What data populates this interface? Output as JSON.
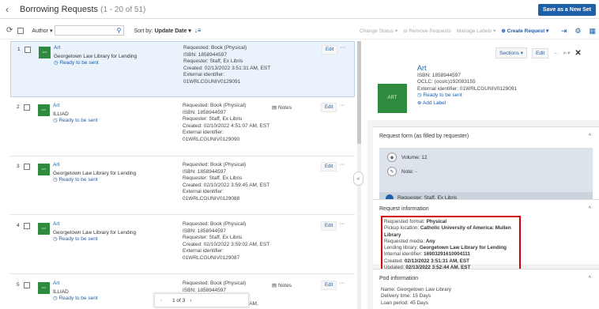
{
  "header": {
    "title": "Borrowing Requests",
    "count": "(1 - 20 of 51)",
    "save_set": "Save as a New Set"
  },
  "toolbar": {
    "facet": "Author ▾",
    "search_placeholder": "",
    "sort_label": "Sort by:",
    "sort_value": "Update Date ▾",
    "actions": [
      "Change Status ▾",
      "Remove Requests",
      "Manage Labels ▾"
    ],
    "create": "Create Request ▾"
  },
  "rows": [
    {
      "n": "1",
      "title": "Art",
      "lib": "Georgetown Law Library for Lending",
      "status": "Ready to be sent",
      "req": "Requested: Book (Physical)",
      "isbn": "ISBN: 1858944597",
      "requester": "Requester: Staff, Ex Libris",
      "created": "Created: 02/13/2022 3:51:31 AM, EST",
      "ext": "External identifier:",
      "extid": "01WRLCGUNIV0129091",
      "notes": ""
    },
    {
      "n": "2",
      "title": "Art",
      "lib": "ILLIAD",
      "status": "Ready to be sent",
      "req": "Requested: Book (Physical)",
      "isbn": "ISBN: 1858944597",
      "requester": "Requester: Staff, Ex Libris",
      "created": "Created: 02/10/2022 4:51:07 AM, EST",
      "ext": "External identifier:",
      "extid": "01WRLCGUNIV0129090",
      "notes": "Notes"
    },
    {
      "n": "3",
      "title": "Art",
      "lib": "Georgetown Law Library for Lending",
      "status": "Ready to be sent",
      "req": "Requested: Book (Physical)",
      "isbn": "ISBN: 1858944597",
      "requester": "Requester: Staff, Ex Libris",
      "created": "Created: 02/10/2022 3:59:45 AM, EST",
      "ext": "External identifier:",
      "extid": "01WRLCGUNIV0129088",
      "notes": ""
    },
    {
      "n": "4",
      "title": "Art",
      "lib": "Georgetown Law Library for Lending",
      "status": "Ready to be sent",
      "req": "Requested: Book (Physical)",
      "isbn": "ISBN: 1858944597",
      "requester": "Requester: Staff, Ex Libris",
      "created": "Created: 02/10/2022 3:59:02 AM, EST",
      "ext": "External identifier:",
      "extid": "01WRLCGUNIV0129087",
      "notes": ""
    },
    {
      "n": "5",
      "title": "Art",
      "lib": "ILLIAD",
      "status": "Ready to be sent",
      "req": "Requested: Book (Physical)",
      "isbn": "ISBN: 1858944597",
      "requester": "Requester: Staff, Ex Libris",
      "created": "Created: 02/10/2022 3:50:25 AM,",
      "ext": "",
      "extid": "",
      "notes": "Notes"
    }
  ],
  "row_actions": {
    "edit": "Edit",
    "more": "···"
  },
  "pager": {
    "label": "1 of 3"
  },
  "panel": {
    "sections_btn": "Sections ▾",
    "edit_btn": "Edit",
    "title": "Art",
    "isbn": "ISBN: 1858944597",
    "oclc": "OCLC: (ocolc)192083155",
    "extid": "External identifier: 01WRLCGUNIV0129091",
    "status": "Ready to be sent",
    "add_label": "Add Label",
    "form_section": "Request form (as filled by requester)",
    "volume": "Volume: 12",
    "note": "Note: -",
    "requester": "Requester: Staff, Ex Libris",
    "info_section": "Request information",
    "info": [
      {
        "k": "Requested format:",
        "v": "Physical"
      },
      {
        "k": "Pickup location:",
        "v": "Catholic University of America: Mullen Library"
      },
      {
        "k": "Requested media:",
        "v": "Any"
      },
      {
        "k": "Lending library:",
        "v": "Georgetown Law Library for Lending"
      },
      {
        "k": "Internal identifier:",
        "v": "16903291610004111"
      },
      {
        "k": "Created:",
        "v": "02/13/2022 3:51:31 AM, EST"
      },
      {
        "k": "Updated:",
        "v": "02/13/2022 3:52:44 AM, EST"
      }
    ],
    "pod_section": "Pod information",
    "pod": [
      "Name: Georgetown Law Library",
      "Delivery time: 15 Days",
      "Loan period: 45 Days"
    ]
  }
}
